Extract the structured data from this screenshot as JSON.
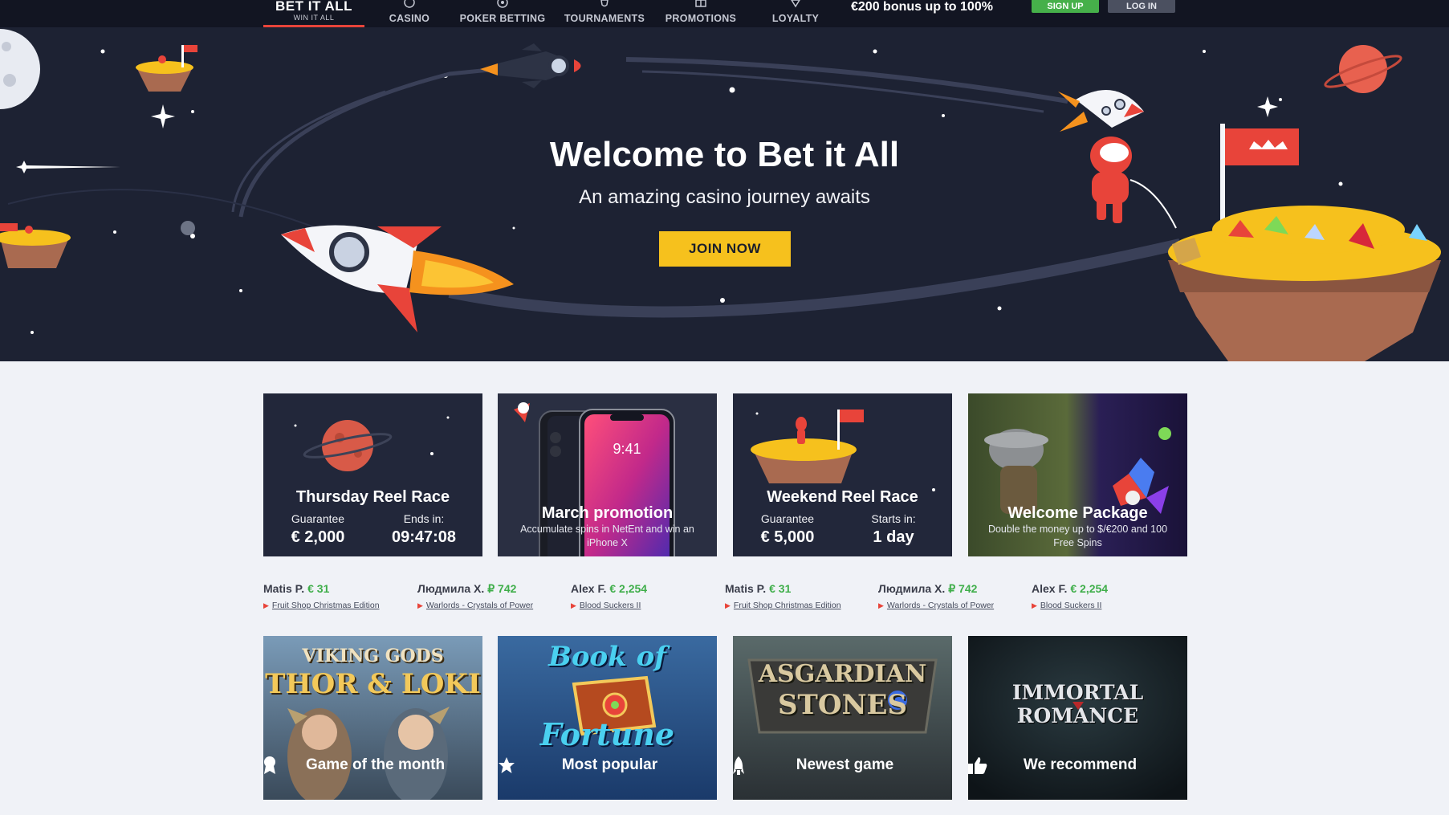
{
  "header": {
    "logo": {
      "brand": "BET IT ALL",
      "tagline": "WIN IT ALL"
    },
    "nav": [
      {
        "label": "CASINO",
        "icon": "casino-icon"
      },
      {
        "label": "POKER BETTING",
        "icon": "poker-icon"
      },
      {
        "label": "TOURNAMENTS",
        "icon": "trophy-icon"
      },
      {
        "label": "PROMOTIONS",
        "icon": "gift-icon"
      },
      {
        "label": "LOYALTY",
        "icon": "diamond-icon"
      }
    ],
    "bonus_text": "€200 bonus up to 100%",
    "signup_label": "SIGN UP",
    "login_label": "LOG IN"
  },
  "hero": {
    "title": "Welcome to Bet it All",
    "subtitle": "An amazing casino journey awaits",
    "cta_label": "JOIN NOW"
  },
  "promos": [
    {
      "title": "Thursday Reel Race",
      "left_label": "Guarantee",
      "left_value": "€ 2,000",
      "right_label": "Ends in:",
      "right_value": "09:47:08"
    },
    {
      "title": "March promotion",
      "description": "Accumulate spins in NetEnt and win an iPhone X",
      "phone_time": "9:41"
    },
    {
      "title": "Weekend Reel Race",
      "left_label": "Guarantee",
      "left_value": "€ 5,000",
      "right_label": "Starts in:",
      "right_value": "1 day"
    },
    {
      "title": "Welcome Package",
      "description": "Double the money up to $/€200 and 100 Free Spins"
    }
  ],
  "winners": [
    {
      "name": "Matis P.",
      "amount": "€ 31",
      "game": "Fruit Shop Christmas Edition"
    },
    {
      "name": "Людмила Х.",
      "amount": "₽ 742",
      "game": "Warlords - Crystals of Power"
    },
    {
      "name": "Alex F.",
      "amount": "€ 2,254",
      "game": "Blood Suckers II"
    },
    {
      "name": "Matis P.",
      "amount": "€ 31",
      "game": "Fruit Shop Christmas Edition"
    },
    {
      "name": "Людмила Х.",
      "amount": "₽ 742",
      "game": "Warlords - Crystals of Power"
    },
    {
      "name": "Alex F.",
      "amount": "€ 2,254",
      "game": "Blood Suckers II"
    }
  ],
  "games": [
    {
      "title_line1": "VIKING GODS",
      "title_line2": "THOR & LOKI",
      "label": "Game of the month",
      "icon": "medal-icon"
    },
    {
      "title_line1": "Book of",
      "title_line2": "Fortune",
      "label": "Most popular",
      "icon": "star-icon"
    },
    {
      "title_line1": "ASGARDIAN",
      "title_line2": "STONES",
      "label": "Newest game",
      "icon": "rocket-icon"
    },
    {
      "title_line1": "IMMORTAL ROMANCE",
      "title_line2": "",
      "label": "We recommend",
      "icon": "thumbs-up-icon"
    }
  ],
  "colors": {
    "nav_bg": "#121522",
    "hero_bg": "#1d2233",
    "accent_red": "#e8443a",
    "cta_yellow": "#f6c11d",
    "signup_green": "#46b04a",
    "winner_green": "#3fae4a",
    "page_bg": "#f0f2f7"
  }
}
